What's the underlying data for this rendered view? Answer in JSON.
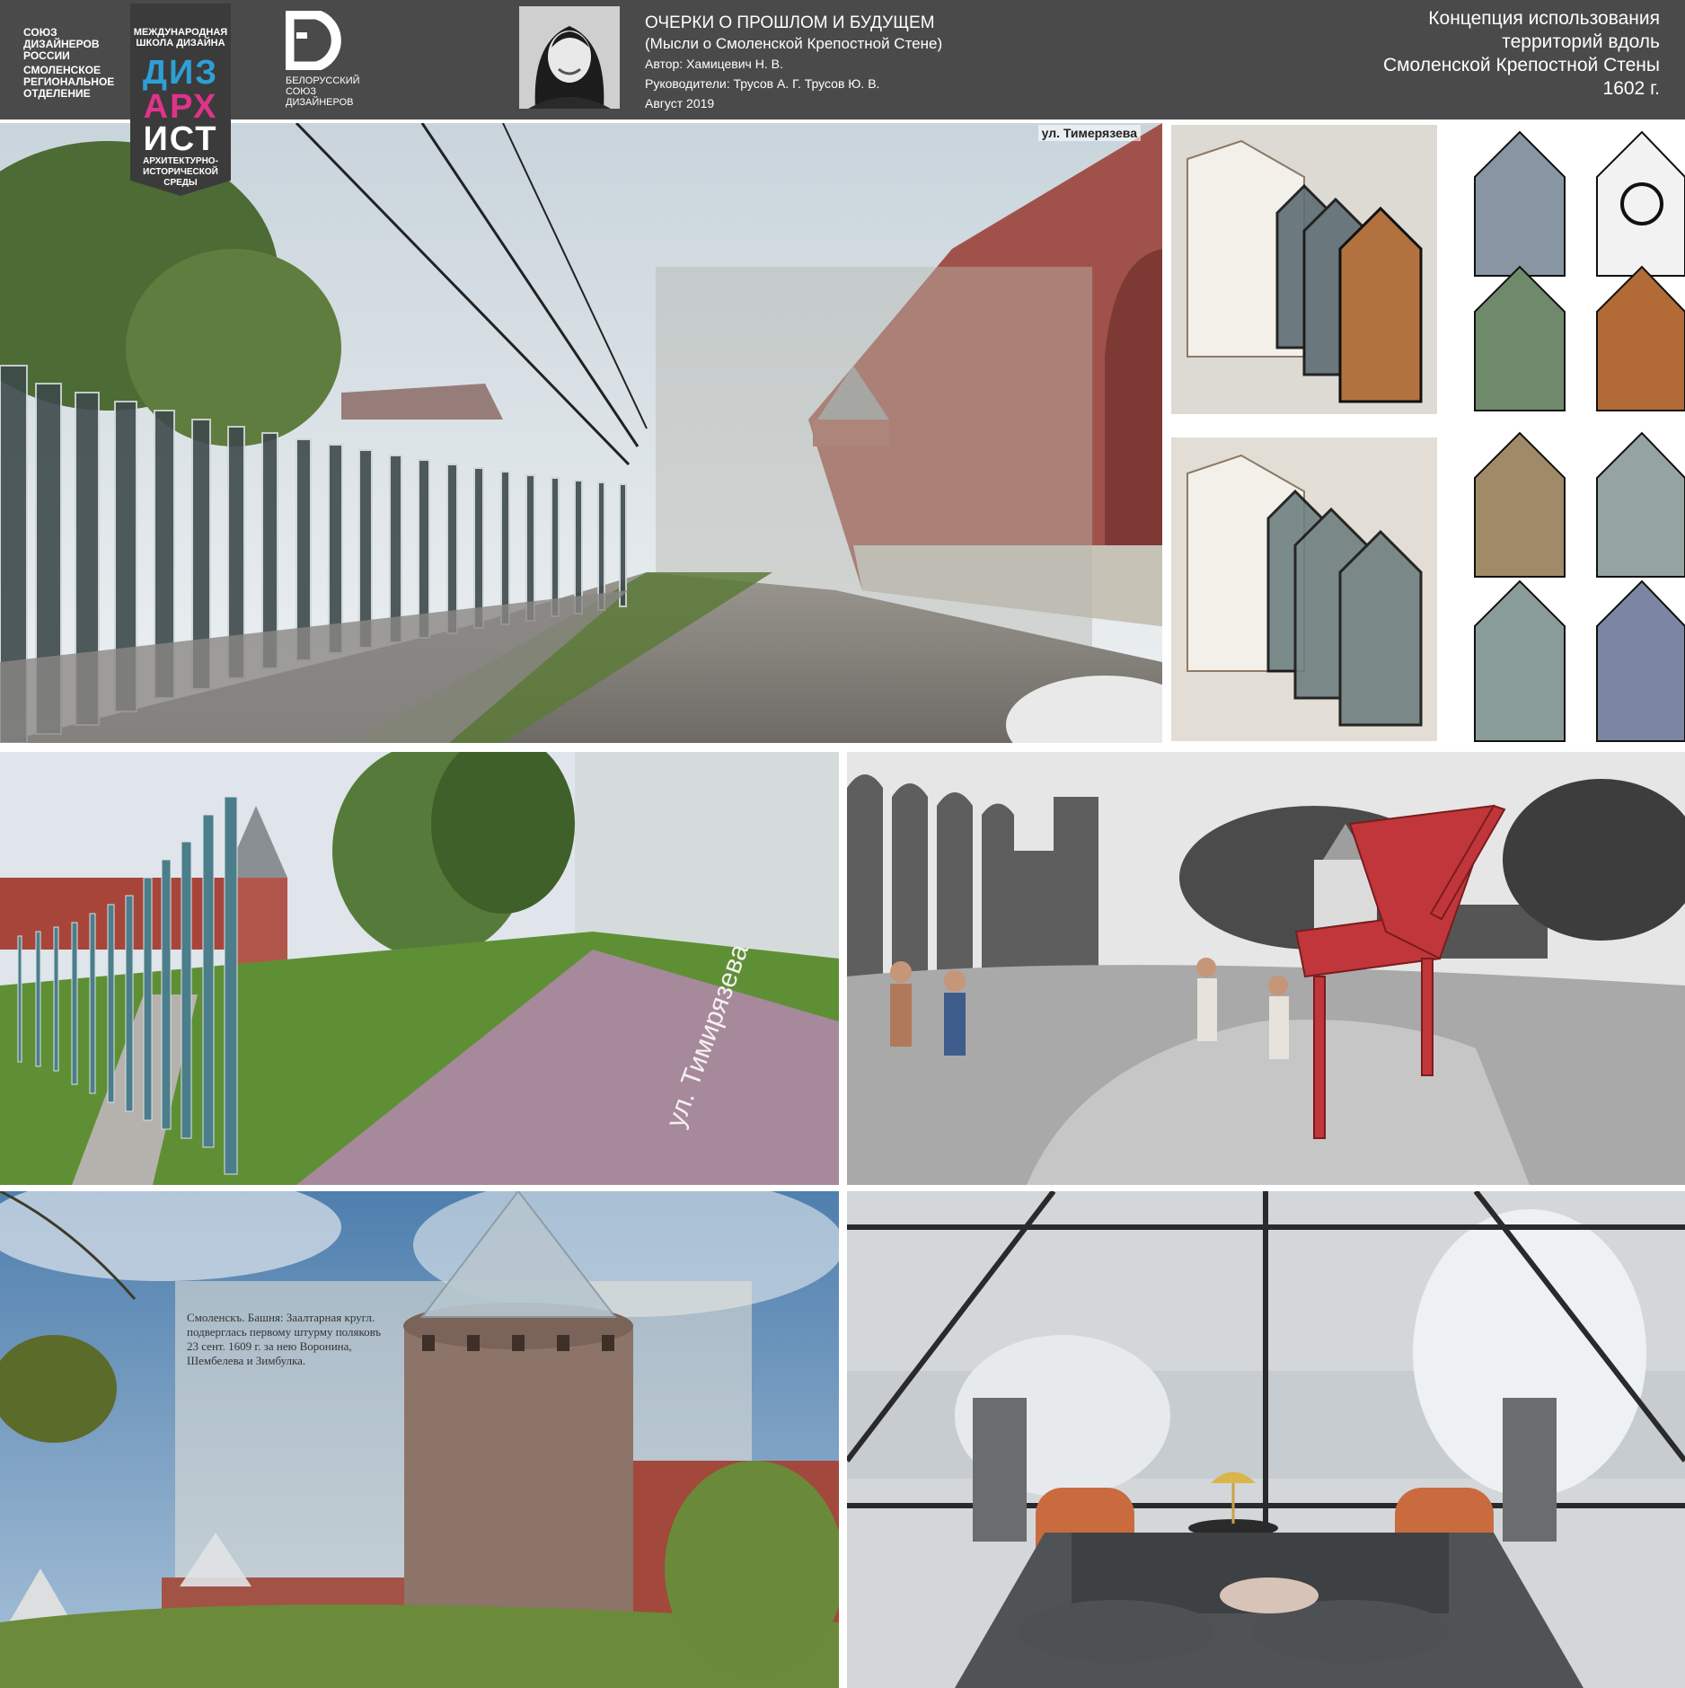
{
  "header": {
    "union_lines": [
      "СОЮЗ",
      "ДИЗАЙНЕРОВ",
      "РОССИИ",
      "СМОЛЕНСКОЕ",
      "РЕГИОНАЛЬНОЕ",
      "ОТДЕЛЕНИЕ"
    ],
    "school": {
      "top_lines": [
        "МЕЖДУНАРОДНАЯ",
        "ШКОЛА ДИЗАЙНА"
      ],
      "logo_lines": [
        "ДИЗ",
        "АРХ",
        "ИСТ"
      ],
      "bottom_lines": [
        "АРХИТЕКТУРНО-",
        "ИСТОРИЧЕСКОЙ",
        "СРЕДЫ"
      ],
      "colors": {
        "blue": "#2e9fd6",
        "pink": "#e0338a",
        "badge_bg": "#3b3b3b"
      }
    },
    "belarus_union_lines": [
      "БЕЛОРУССКИЙ",
      "СОЮЗ",
      "ДИЗАЙНЕРОВ"
    ],
    "project": {
      "title": "ОЧЕРКИ О ПРОШЛОМ И БУДУЩЕМ",
      "subtitle": "(Мысли о Смоленской Крепостной Стене)",
      "author": "Автор: Хамицевич Н. В.",
      "supervisors": "Руководители: Трусов А. Г. Трусов Ю. В.",
      "date": "Август   2019"
    },
    "concept_lines": [
      "Концепция использования",
      "территорий вдоль",
      "Смоленской Крепостной Стены",
      "1602 г."
    ],
    "bg_color": "#4a4a4a"
  },
  "photos": {
    "street_label": "ул. Тимерязева",
    "street_sign": "ул. Тимирязева",
    "postcard_lines": [
      "Смоленскъ.  Башня: Заалтарная кругл.",
      "подверглась первому штурму поляковъ",
      "23 сент. 1609 г. за нею Воронина,",
      "Шембелева и Зимбулка."
    ]
  }
}
